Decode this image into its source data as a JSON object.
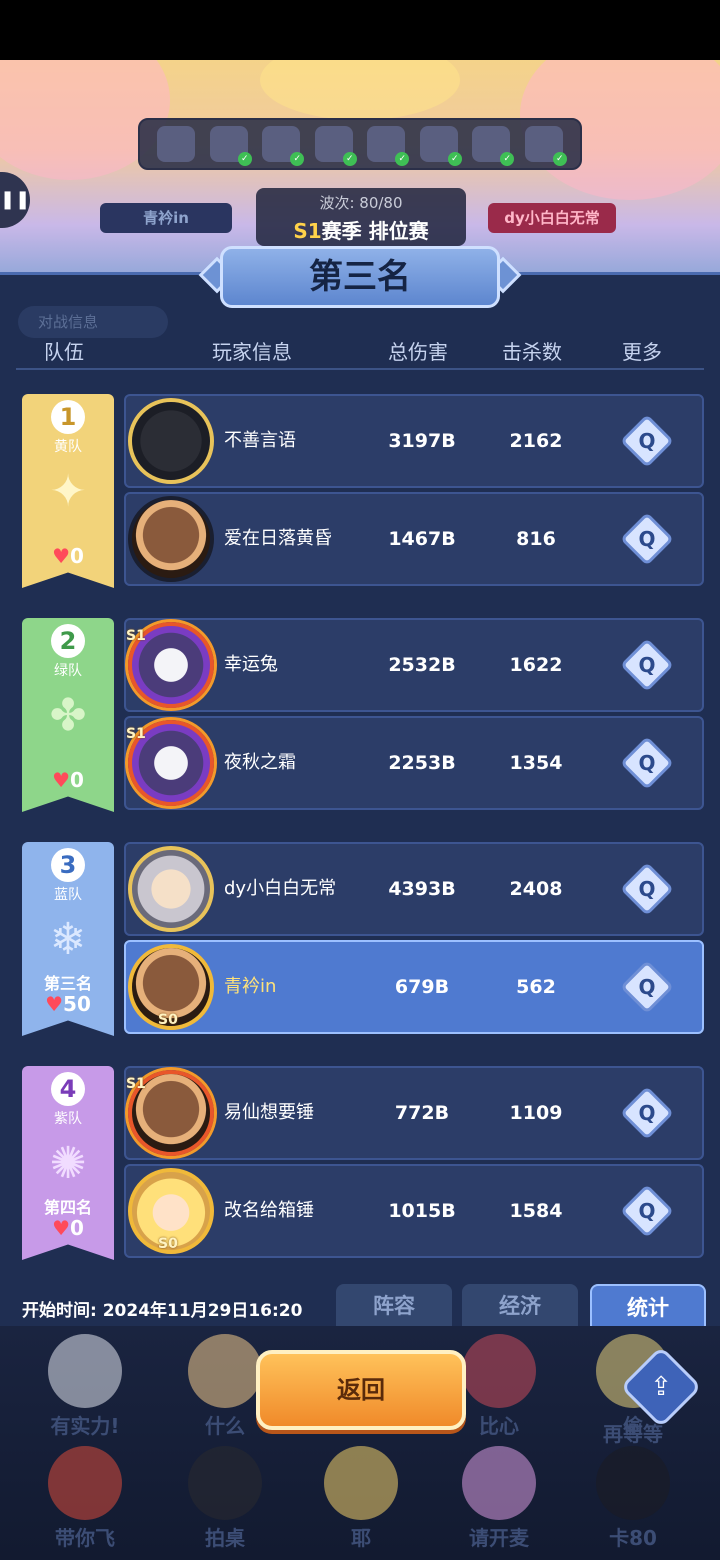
{
  "scene": {
    "wave_text": "波次: 80/80",
    "season_s1": "S1",
    "season_rest": "赛季 排位赛",
    "left_player": "青衿in",
    "right_player": "dy小白白无常",
    "pause_icon": "pause-icon"
  },
  "result": {
    "rank_title": "第三名",
    "battle_info_tab": "对战信息"
  },
  "headers": {
    "team": "队伍",
    "player": "玩家信息",
    "damage": "总伤害",
    "kills": "击杀数",
    "more": "更多"
  },
  "teams": [
    {
      "num": "1",
      "name": "黄队",
      "rank": "",
      "hearts": "0",
      "emblem_icon": "star-emblem-icon",
      "color": "#f2d37a",
      "num_color": "#c8962a",
      "players": [
        {
          "name": "不善言语",
          "damage": "3197B",
          "kills": "2162",
          "avatar_icon": "dragon-avatar-icon"
        },
        {
          "name": "爱在日落黄昏",
          "damage": "1467B",
          "kills": "816",
          "avatar_icon": "girl-avatar-icon"
        }
      ]
    },
    {
      "num": "2",
      "name": "绿队",
      "rank": "",
      "hearts": "0",
      "emblem_icon": "clover-emblem-icon",
      "color": "#8ed68a",
      "num_color": "#3f9a4a",
      "players": [
        {
          "name": "幸运兔",
          "damage": "2532B",
          "kills": "1622",
          "avatar_icon": "penguin-avatar-icon",
          "tag": "S1"
        },
        {
          "name": "夜秋之霜",
          "damage": "2253B",
          "kills": "1354",
          "avatar_icon": "penguin-avatar-icon",
          "tag": "S1"
        }
      ]
    },
    {
      "num": "3",
      "name": "蓝队",
      "rank": "第三名",
      "hearts": "50",
      "emblem_icon": "snowflake-emblem-icon",
      "color": "#8fb4ec",
      "num_color": "#3a6cc0",
      "players": [
        {
          "name": "dy小白白无常",
          "damage": "4393B",
          "kills": "2408",
          "avatar_icon": "angel-avatar-icon"
        },
        {
          "name": "青衿in",
          "damage": "679B",
          "kills": "562",
          "avatar_icon": "girl-avatar-icon",
          "tag": "S0",
          "is_me": true
        }
      ]
    },
    {
      "num": "4",
      "name": "紫队",
      "rank": "第四名",
      "hearts": "0",
      "emblem_icon": "swirl-emblem-icon",
      "color": "#c79ae8",
      "num_color": "#7a3cb8",
      "players": [
        {
          "name": "易仙想要锤",
          "damage": "772B",
          "kills": "1109",
          "avatar_icon": "girl-avatar-icon",
          "tag": "S1"
        },
        {
          "name": "改名给箱锤",
          "damage": "1015B",
          "kills": "1584",
          "avatar_icon": "blonde-avatar-icon",
          "tag": "S0"
        }
      ]
    }
  ],
  "footer": {
    "start_time": "开始时间: 2024年11月29日16:20",
    "tabs": [
      "阵容",
      "经济",
      "统计"
    ],
    "active_tab": "统计"
  },
  "emotes": [
    "有实力!",
    "什么",
    "比心",
    "偷",
    "带你飞",
    "拍桌",
    "耶",
    "请开麦",
    "卡80",
    "再等等"
  ],
  "buttons": {
    "back": "返回",
    "share_icon": "share-icon"
  }
}
